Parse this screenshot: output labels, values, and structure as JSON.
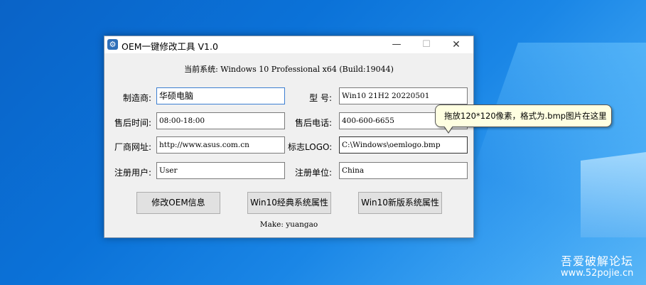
{
  "window": {
    "title": "OEM一键修改工具  V1.0",
    "icon": "gear-icon",
    "controls": {
      "minimize": "—",
      "maximize": "☐",
      "close": "✕"
    }
  },
  "status_text": "当前系统: Windows 10 Professional x64 (Build:19044)",
  "form": {
    "manufacturer_label": "制造商:",
    "manufacturer_value": "华硕电脑",
    "model_label": "型    号:",
    "model_value": "Win10 21H2 20220501",
    "support_hours_label": "售后时间:",
    "support_hours_value": "08:00-18:00",
    "support_phone_label": "售后电话:",
    "support_phone_value": "400-600-6655",
    "support_url_label": "厂商网址:",
    "support_url_value": "http://www.asus.com.cn",
    "logo_label": "标志LOGO:",
    "logo_value": "C:\\Windows\\oemlogo.bmp",
    "owner_label": "注册用户:",
    "owner_value": "User",
    "organization_label": "注册单位:",
    "organization_value": "China"
  },
  "buttons": {
    "modify_oem": "修改OEM信息",
    "classic_props": "Win10经典系统属性",
    "new_props": "Win10新版系统属性"
  },
  "footer_text": "Make: yuangao",
  "tooltip_text": "拖放120*120像素，格式为.bmp图片在这里",
  "watermark": {
    "line1": "吾爱破解论坛",
    "line2": "www.52pojie.cn"
  }
}
